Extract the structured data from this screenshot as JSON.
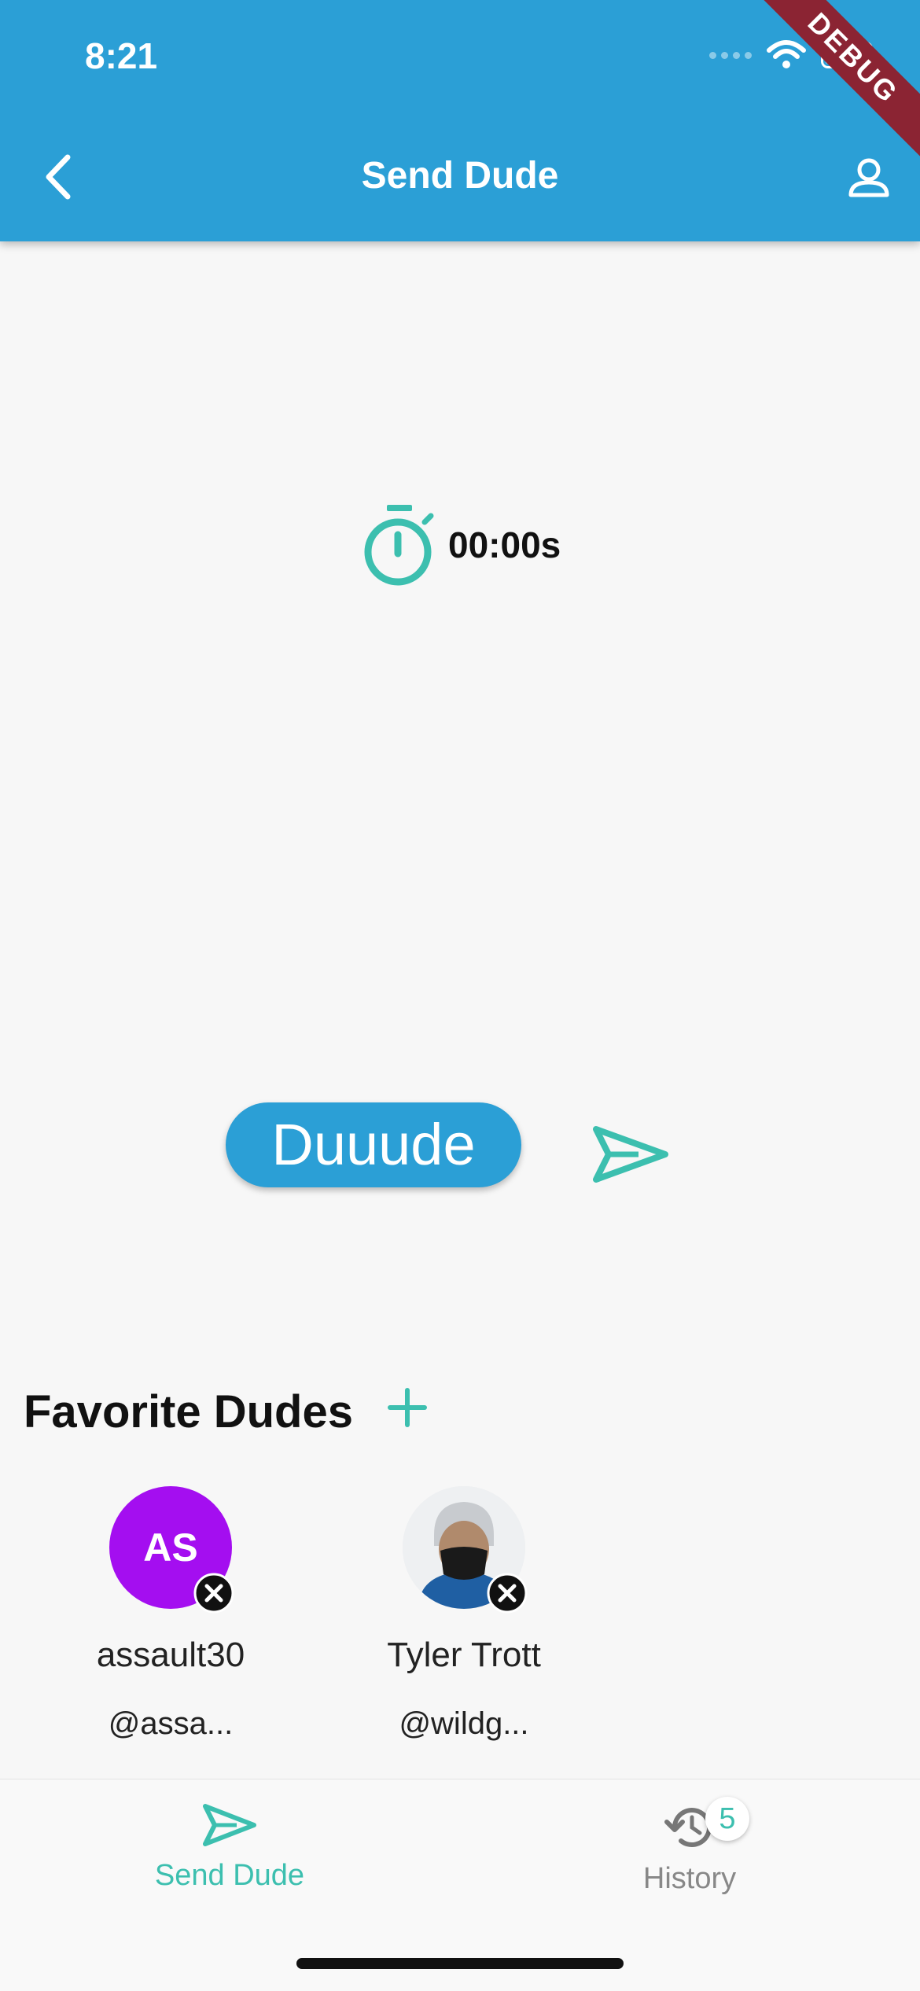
{
  "status_bar": {
    "time": "8:21",
    "debug_label": "DEBUG"
  },
  "app_bar": {
    "title": "Send Dude",
    "back_icon": "chevron-left-icon",
    "profile_icon": "person-icon"
  },
  "timer": {
    "icon": "stopwatch-icon",
    "value": "00:00s"
  },
  "dude_button": {
    "label": "Duuude"
  },
  "send_icon": "paper-plane-icon",
  "favorites": {
    "title": "Favorite Dudes",
    "add_icon": "plus-icon",
    "items": [
      {
        "initials": "AS",
        "name": "assault30",
        "handle": "@assa..."
      },
      {
        "initials": "",
        "name": "Tyler Trott",
        "handle": "@wildg..."
      }
    ]
  },
  "bottom_nav": {
    "items": [
      {
        "label": "Send Dude",
        "icon": "paper-plane-icon",
        "active": true
      },
      {
        "label": "History",
        "icon": "history-icon",
        "badge": "5",
        "active": false
      }
    ]
  },
  "colors": {
    "primary": "#2b9fd6",
    "accent": "#3cbfaf",
    "avatar_purple": "#a40ef0",
    "debug": "#8b2433"
  }
}
